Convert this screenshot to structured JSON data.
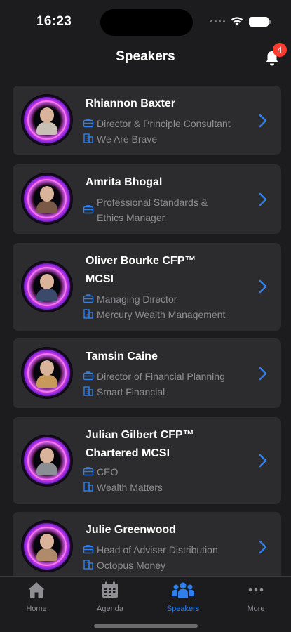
{
  "status": {
    "time": "16:23"
  },
  "header": {
    "title": "Speakers",
    "notification_count": "4"
  },
  "speakers": [
    {
      "name": "Rhiannon Baxter",
      "role": "Director & Principle Consultant",
      "company": "We Are Brave",
      "photo_color": "#c9c0b5"
    },
    {
      "name": "Amrita Bhogal",
      "role": "Professional Standards & Ethics Manager",
      "company": "",
      "photo_color": "#7a5a46"
    },
    {
      "name": "Oliver Bourke CFP™ MCSI",
      "role": "Managing Director",
      "company": "Mercury Wealth Management",
      "photo_color": "#3b4a6b"
    },
    {
      "name": "Tamsin Caine",
      "role": "Director of Financial Planning",
      "company": "Smart Financial",
      "photo_color": "#c79a5a"
    },
    {
      "name": "Julian Gilbert CFP™ Chartered MCSI",
      "role": "CEO",
      "company": "Wealth Matters",
      "photo_color": "#8a8f96"
    },
    {
      "name": "Julie Greenwood",
      "role": "Head of Adviser Distribution",
      "company": "Octopus Money",
      "photo_color": "#b08a6a"
    }
  ],
  "tabbar": {
    "home": "Home",
    "agenda": "Agenda",
    "speakers": "Speakers",
    "more": "More"
  },
  "colors": {
    "accent": "#2f80ed",
    "card": "#2c2c2e",
    "background": "#1c1c1e",
    "badge": "#ff3b30"
  }
}
